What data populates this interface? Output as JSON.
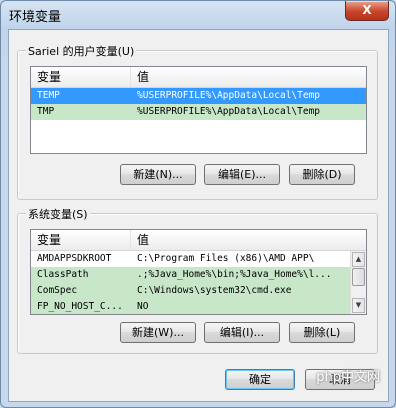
{
  "window": {
    "title": "环境变量",
    "close_glyph": "X"
  },
  "user_vars": {
    "label": "Sariel 的用户变量(U)",
    "col_name": "变量",
    "col_value": "值",
    "rows": [
      {
        "name": "TEMP",
        "value": "%USERPROFILE%\\AppData\\Local\\Temp",
        "state": "selected"
      },
      {
        "name": "TMP",
        "value": "%USERPROFILE%\\AppData\\Local\\Temp",
        "state": "green"
      }
    ],
    "buttons": {
      "new": "新建(N)...",
      "edit": "编辑(E)...",
      "delete": "删除(D)"
    }
  },
  "system_vars": {
    "label": "系统变量(S)",
    "col_name": "变量",
    "col_value": "值",
    "rows": [
      {
        "name": "AMDAPPSDKROOT",
        "value": "C:\\Program Files (x86)\\AMD APP\\",
        "state": "normal"
      },
      {
        "name": "ClassPath",
        "value": ".;%Java_Home%\\bin;%Java_Home%\\l...",
        "state": "green"
      },
      {
        "name": "ComSpec",
        "value": "C:\\Windows\\system32\\cmd.exe",
        "state": "green"
      },
      {
        "name": "FP_NO_HOST_C...",
        "value": "NO",
        "state": "green"
      }
    ],
    "buttons": {
      "new": "新建(W)...",
      "edit": "编辑(I)...",
      "delete": "删除(L)"
    }
  },
  "footer": {
    "ok": "确定",
    "cancel": "取消"
  },
  "watermark": "php中文网",
  "colors": {
    "selected": "#3399ff",
    "highlight_green": "#c8e6c8"
  }
}
